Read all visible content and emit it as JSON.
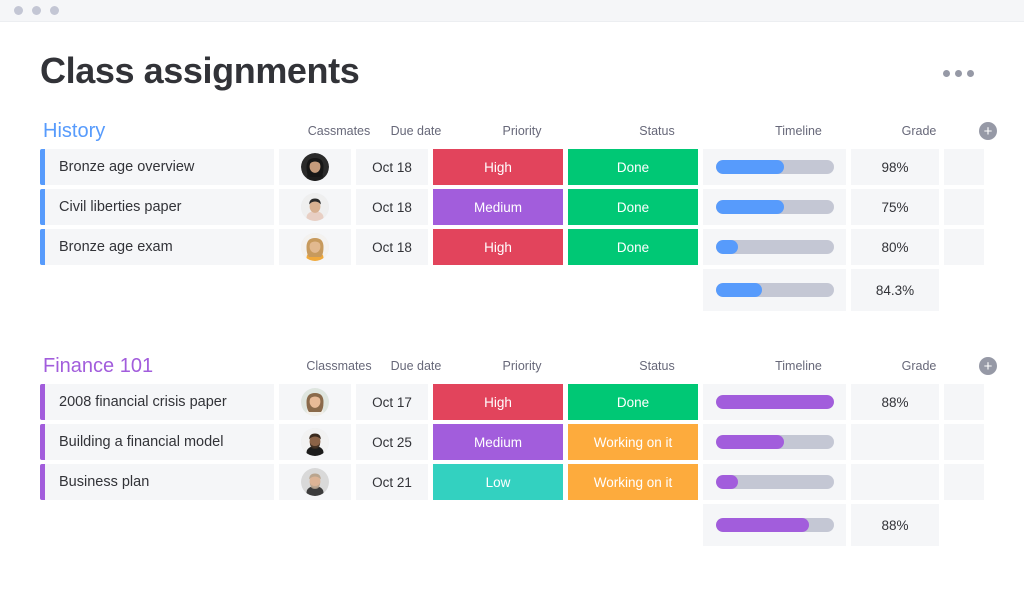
{
  "window": {
    "dots": 3
  },
  "header": {
    "title": "Class assignments",
    "more_label": "more-options"
  },
  "colors": {
    "history_accent": "#579bfc",
    "finance_accent": "#a25ddc",
    "priority_high": "#e2445c",
    "priority_medium": "#a25ddc",
    "priority_low": "#33d1c0",
    "status_done": "#00c875",
    "status_working": "#fdab3d",
    "track_bg": "#c4c7d4"
  },
  "boards": [
    {
      "name": "History",
      "accent": "#579bfc",
      "columns": [
        "Cassmates",
        "Due date",
        "Priority",
        "Status",
        "Timeline",
        "Grade"
      ],
      "add_column_label": "+",
      "rows": [
        {
          "task": "Bronze age overview",
          "avatar": "avatar-woman-dark-hair",
          "date": "Oct 18",
          "priority": "High",
          "priority_color": "#e2445c",
          "status": "Done",
          "status_color": "#00c875",
          "timeline_pct": 58,
          "timeline_color": "#579bfc",
          "grade": "98%"
        },
        {
          "task": "Civil liberties paper",
          "avatar": "avatar-woman-updo",
          "date": "Oct 18",
          "priority": "Medium",
          "priority_color": "#a25ddc",
          "status": "Done",
          "status_color": "#00c875",
          "timeline_pct": 58,
          "timeline_color": "#579bfc",
          "grade": "75%"
        },
        {
          "task": "Bronze age exam",
          "avatar": "avatar-woman-blonde",
          "date": "Oct 18",
          "priority": "High",
          "priority_color": "#e2445c",
          "status": "Done",
          "status_color": "#00c875",
          "timeline_pct": 19,
          "timeline_color": "#579bfc",
          "grade": "80%"
        }
      ],
      "summary": {
        "timeline_pct": 39,
        "timeline_color": "#579bfc",
        "grade": "84.3%"
      }
    },
    {
      "name": "Finance 101",
      "accent": "#a25ddc",
      "columns": [
        "Classmates",
        "Due date",
        "Priority",
        "Status",
        "Timeline",
        "Grade"
      ],
      "add_column_label": "+",
      "rows": [
        {
          "task": "2008 financial crisis paper",
          "avatar": "avatar-woman-smiling",
          "date": "Oct 17",
          "priority": "High",
          "priority_color": "#e2445c",
          "status": "Done",
          "status_color": "#00c875",
          "timeline_pct": 100,
          "timeline_color": "#a25ddc",
          "grade": "88%"
        },
        {
          "task": "Building a financial model",
          "avatar": "avatar-man-beard-dark",
          "date": "Oct 25",
          "priority": "Medium",
          "priority_color": "#a25ddc",
          "status": "Working on it",
          "status_color": "#fdab3d",
          "timeline_pct": 58,
          "timeline_color": "#a25ddc",
          "grade": ""
        },
        {
          "task": "Business plan",
          "avatar": "avatar-man-beard-light",
          "date": "Oct 21",
          "priority": "Low",
          "priority_color": "#33d1c0",
          "status": "Working on it",
          "status_color": "#fdab3d",
          "timeline_pct": 19,
          "timeline_color": "#a25ddc",
          "grade": ""
        }
      ],
      "summary": {
        "timeline_pct": 79,
        "timeline_color": "#a25ddc",
        "grade": "88%"
      }
    }
  ]
}
